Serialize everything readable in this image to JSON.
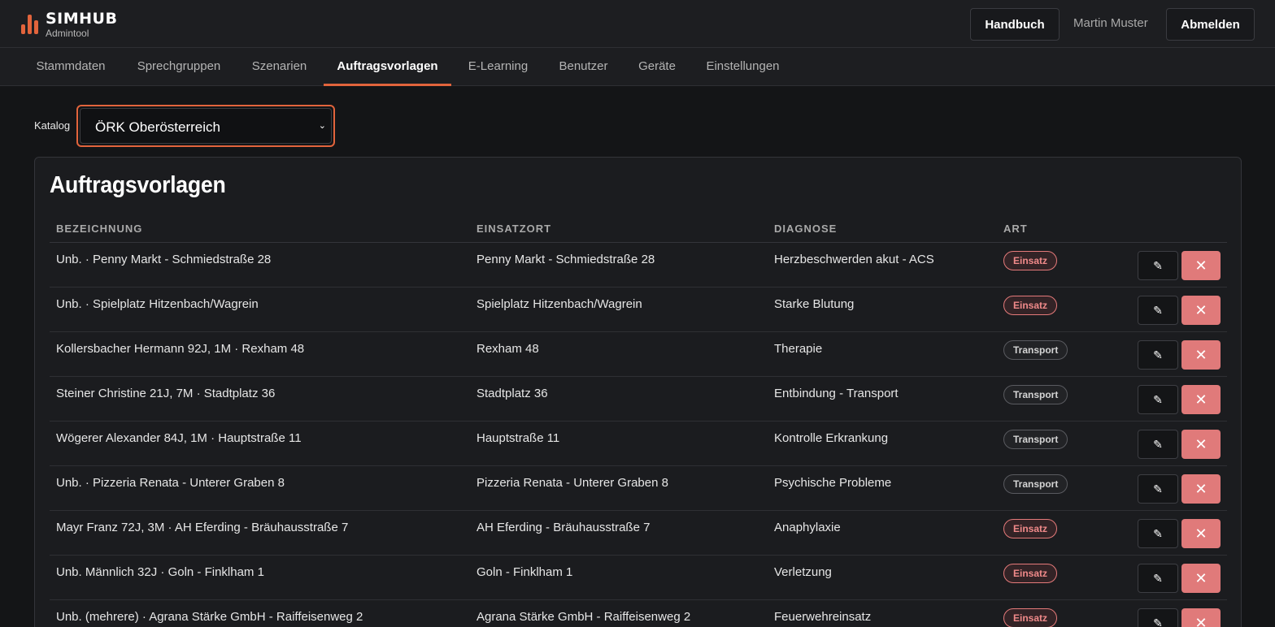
{
  "app": {
    "name": "SIMHUB",
    "subtitle": "Admintool",
    "accent": "#e2643c"
  },
  "header": {
    "manual_label": "Handbuch",
    "user_name": "Martin Muster",
    "logout_label": "Abmelden"
  },
  "nav": {
    "tabs": [
      {
        "label": "Stammdaten"
      },
      {
        "label": "Sprechgruppen"
      },
      {
        "label": "Szenarien"
      },
      {
        "label": "Auftragsvorlagen",
        "active": true
      },
      {
        "label": "E-Learning"
      },
      {
        "label": "Benutzer"
      },
      {
        "label": "Geräte"
      },
      {
        "label": "Einstellungen"
      }
    ]
  },
  "catalog": {
    "label": "Katalog",
    "selected": "ÖRK Oberösterreich"
  },
  "table": {
    "title": "Auftragsvorlagen",
    "columns": [
      "BEZEICHNUNG",
      "EINSATZORT",
      "DIAGNOSE",
      "ART"
    ],
    "rows": [
      {
        "name": "Unb. · Penny Markt - Schmiedstraße 28",
        "location": "Penny Markt - Schmiedstraße 28",
        "diagnosis": "Herzbeschwerden akut - ACS",
        "type": "Einsatz"
      },
      {
        "name": "Unb. · Spielplatz Hitzenbach/Wagrein",
        "location": "Spielplatz Hitzenbach/Wagrein",
        "diagnosis": "Starke Blutung",
        "type": "Einsatz"
      },
      {
        "name": "Kollersbacher Hermann 92J, 1M · Rexham 48",
        "location": "Rexham 48",
        "diagnosis": "Therapie",
        "type": "Transport"
      },
      {
        "name": "Steiner Christine 21J, 7M · Stadtplatz 36",
        "location": "Stadtplatz 36",
        "diagnosis": "Entbindung - Transport",
        "type": "Transport"
      },
      {
        "name": "Wögerer Alexander 84J, 1M · Hauptstraße 11",
        "location": "Hauptstraße 11",
        "diagnosis": "Kontrolle Erkrankung",
        "type": "Transport"
      },
      {
        "name": "Unb. · Pizzeria Renata - Unterer Graben 8",
        "location": "Pizzeria Renata - Unterer Graben 8",
        "diagnosis": "Psychische Probleme",
        "type": "Transport"
      },
      {
        "name": "Mayr Franz 72J, 3M · AH Eferding - Bräuhausstraße 7",
        "location": "AH Eferding - Bräuhausstraße 7",
        "diagnosis": "Anaphylaxie",
        "type": "Einsatz"
      },
      {
        "name": "Unb. Männlich 32J · Goln - Finklham 1",
        "location": "Goln - Finklham 1",
        "diagnosis": "Verletzung",
        "type": "Einsatz"
      },
      {
        "name": "Unb. (mehrere) · Agrana Stärke GmbH - Raiffeisenweg 2",
        "location": "Agrana Stärke GmbH - Raiffeisenweg 2",
        "diagnosis": "Feuerwehreinsatz",
        "type": "Einsatz"
      }
    ],
    "edit_icon": "pencil-icon",
    "delete_icon": "close-icon",
    "delete_color": "#e07a7a"
  }
}
